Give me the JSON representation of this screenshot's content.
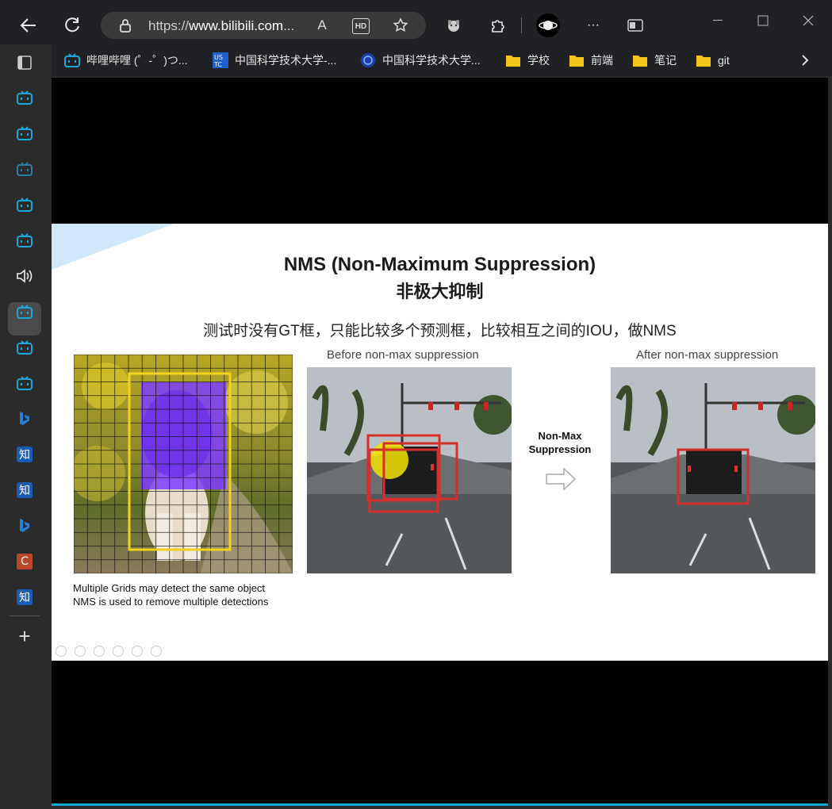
{
  "browser": {
    "url_prefix": "https://",
    "url_host": "www.bilibili.com",
    "url_tail": "...",
    "read_aloud_icon": "A",
    "hd_icon": "HD",
    "more_icon": "···"
  },
  "bookmarks": [
    {
      "label": "哔哩哔哩 (゜-゜)つ...",
      "icon": "bilibili-icon"
    },
    {
      "label": "中国科学技术大学-...",
      "icon": "ustc-icon"
    },
    {
      "label": "中国科学技术大学...",
      "icon": "ustc-seal-icon"
    },
    {
      "label": "学校",
      "icon": "folder-icon"
    },
    {
      "label": "前端",
      "icon": "folder-icon"
    },
    {
      "label": "笔记",
      "icon": "folder-icon"
    },
    {
      "label": "git",
      "icon": "folder-icon"
    }
  ],
  "sidebar": {
    "zhi_label": "知",
    "c_label": "C",
    "add_label": "+"
  },
  "slide": {
    "title": "NMS (Non-Maximum Suppression)",
    "subtitle": "非极大抑制",
    "description": "测试时没有GT框，只能比较多个预测框，比较相互之间的IOU，做NMS",
    "before_caption": "Before non-max suppression",
    "after_caption": "After non-max suppression",
    "arrow_label_line1": "Non-Max",
    "arrow_label_line2": "Suppression",
    "note_line1": "Multiple Grids may detect the same object",
    "note_line2": "NMS is used to remove multiple detections"
  },
  "colors": {
    "bilibili_blue": "#1fa6d8",
    "accent_red": "#d32f2f",
    "box_yellow": "#f2d21b",
    "dog_overlay": "#7c3cff"
  }
}
